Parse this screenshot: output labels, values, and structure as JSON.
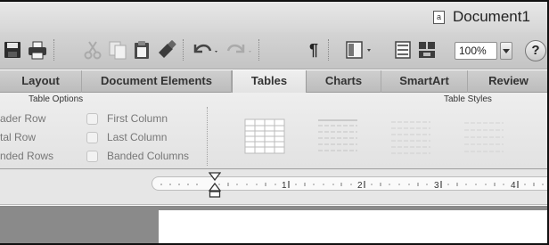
{
  "window": {
    "title": "Document1",
    "doc_icon_glyph": "a"
  },
  "toolbar": {
    "icons": [
      "save-icon",
      "print-icon",
      "cut-icon",
      "copy-icon",
      "paste-icon",
      "format-painter-icon",
      "undo-icon",
      "redo-icon",
      "paragraph-marks-icon",
      "view-layout-icon",
      "sidebar-icon",
      "gallery-icon"
    ],
    "zoom_value": "100%",
    "help_label": "?"
  },
  "ribbon_tabs": [
    {
      "label": "Layout",
      "active": false
    },
    {
      "label": "Document Elements",
      "active": false
    },
    {
      "label": "Tables",
      "active": true
    },
    {
      "label": "Charts",
      "active": false
    },
    {
      "label": "SmartArt",
      "active": false
    },
    {
      "label": "Review",
      "active": false
    }
  ],
  "table_options": {
    "title": "Table Options",
    "left_column": [
      "ader Row",
      "tal Row",
      "nded Rows"
    ],
    "right_column": [
      "First Column",
      "Last Column",
      "Banded Columns"
    ]
  },
  "table_styles": {
    "title": "Table Styles",
    "swatch_count": 4
  },
  "ruler": {
    "labels": [
      "1",
      "2",
      "3",
      "4"
    ]
  },
  "colors": {
    "toolbar_bg": "#c8c8c8",
    "ribbon_bg": "#e8e8e8",
    "canvas_bg": "#8a8a8a"
  }
}
